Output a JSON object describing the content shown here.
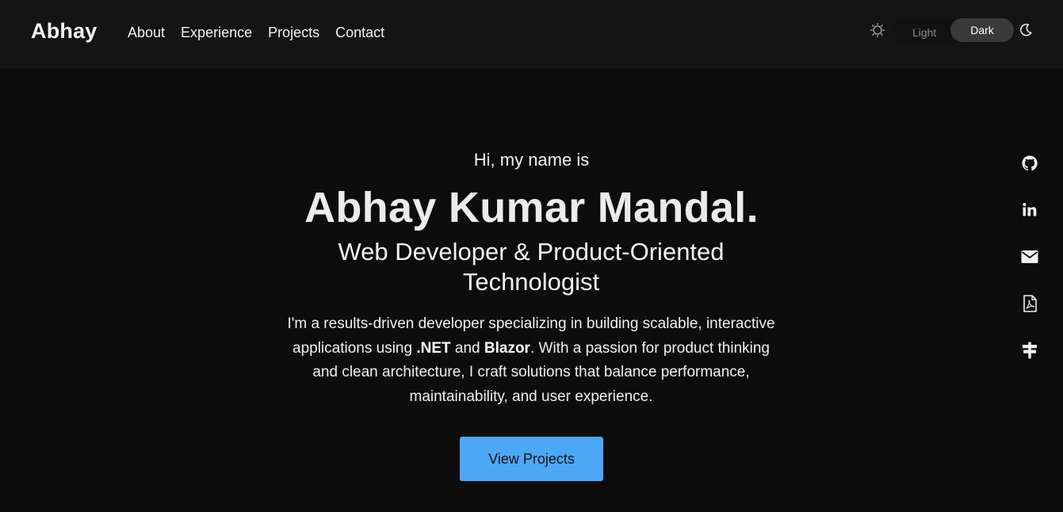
{
  "nav": {
    "brand": "Abhay",
    "links": [
      "About",
      "Experience",
      "Projects",
      "Contact"
    ]
  },
  "theme": {
    "light_label": "Light",
    "dark_label": "Dark",
    "selected": "Dark",
    "icons": [
      "sun-icon",
      "moon-icon"
    ]
  },
  "hero": {
    "greeting": "Hi, my name is",
    "name": "Abhay Kumar Mandal.",
    "role": "Web Developer & Product-Oriented Technologist",
    "intro": {
      "part1": "I'm a results-driven developer specializing in building scalable, interactive applications using ",
      "tech1": ".NET",
      "part2": " and ",
      "tech2": "Blazor",
      "part3": ". With a passion for product thinking and clean architecture, I craft solutions that balance performance, maintainability, and user experience."
    },
    "cta_label": "View Projects"
  },
  "social": [
    "github-icon",
    "linkedin-icon",
    "email-icon",
    "pdf-resume-icon",
    "signpost-icon"
  ],
  "colors": {
    "background": "#0d0d0d",
    "navbar": "#141414",
    "accent": "#4aa8f5",
    "toggle_active": "#3a3a3a"
  }
}
